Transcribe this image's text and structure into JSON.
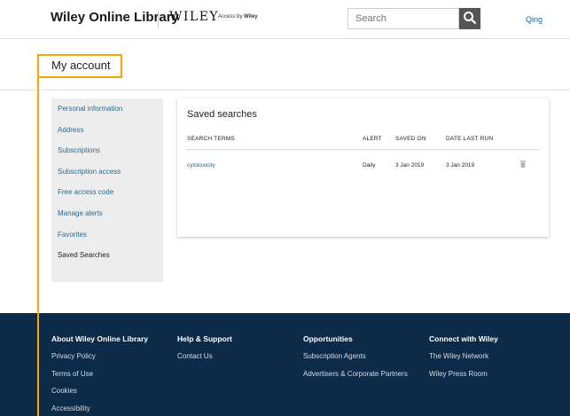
{
  "header": {
    "logo": "Wiley Online Library",
    "wiley_word": "WILEY",
    "access_by_prefix": "Access by",
    "access_by_org": "Wiley",
    "search_placeholder": "Search",
    "user_name": "Qing"
  },
  "account": {
    "title": "My account"
  },
  "sidebar": {
    "items": [
      {
        "label": "Personal information"
      },
      {
        "label": "Address"
      },
      {
        "label": "Subscriptions"
      },
      {
        "label": "Subscription access"
      },
      {
        "label": "Free access code"
      },
      {
        "label": "Manage alerts"
      },
      {
        "label": "Favorites"
      },
      {
        "label": "Saved Searches",
        "active": true
      }
    ]
  },
  "saved_searches": {
    "title": "Saved searches",
    "columns": [
      "SEARCH TERMS",
      "ALERT",
      "SAVED ON",
      "DATE LAST RUN"
    ],
    "rows": [
      {
        "term": "cytotoxicity",
        "alert": "Daily",
        "saved_on": "3 Jan 2019",
        "last_run": "3 Jan 2019"
      }
    ]
  },
  "footer": {
    "columns": [
      {
        "heading": "About Wiley Online Library",
        "links": [
          "Privacy Policy",
          "Terms of Use",
          "Cookies",
          "Accessibility"
        ]
      },
      {
        "heading": "Help & Support",
        "links": [
          "Contact Us"
        ]
      },
      {
        "heading": "Opportunities",
        "links": [
          "Subscription Agents",
          "Advertisers & Corporate Partners"
        ]
      },
      {
        "heading": "Connect with Wiley",
        "links": [
          "The Wiley Network",
          "Wiley Press Room"
        ]
      }
    ]
  },
  "colors": {
    "accent_annotation": "#f5a800",
    "link": "#2b6a8e",
    "footer_bg": "#0c2b49",
    "sidebar_bg": "#ededed"
  }
}
